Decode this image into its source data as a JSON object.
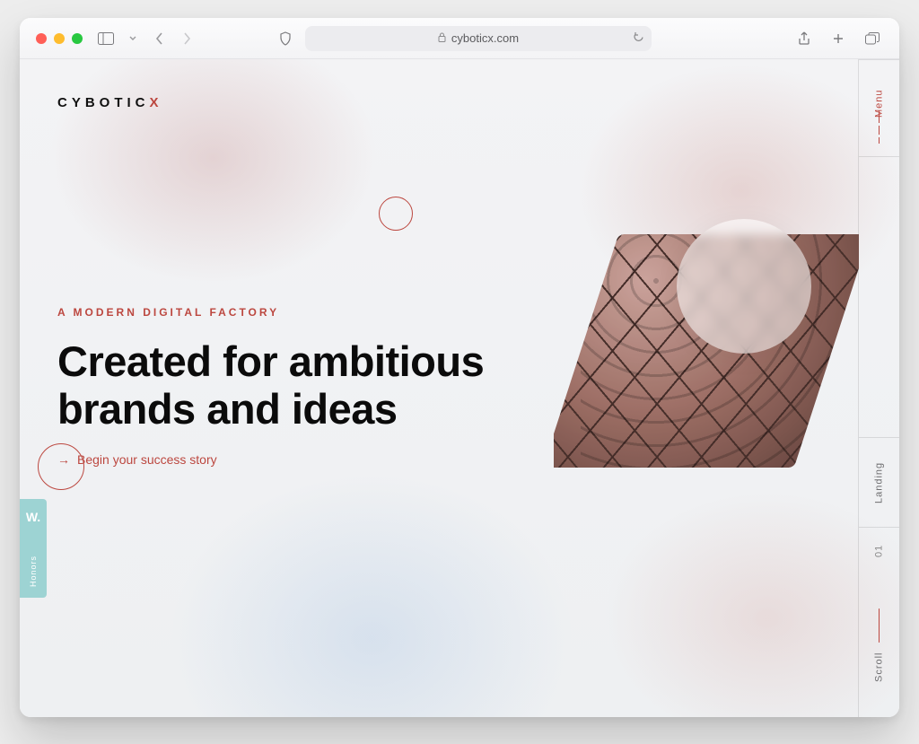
{
  "browser": {
    "url_display": "cyboticx.com"
  },
  "logo": {
    "text_prefix": "CYBOTIC",
    "text_suffix": "X"
  },
  "rail": {
    "menu": "Menu",
    "landing": "Landing",
    "index": "01",
    "scroll": "Scroll"
  },
  "honors": {
    "badge": "W.",
    "label": "Honors"
  },
  "hero": {
    "eyebrow": "A MODERN DIGITAL FACTORY",
    "headline_l1": "Created for ambitious",
    "headline_l2": "brands and ideas",
    "cta": "Begin your success story"
  }
}
